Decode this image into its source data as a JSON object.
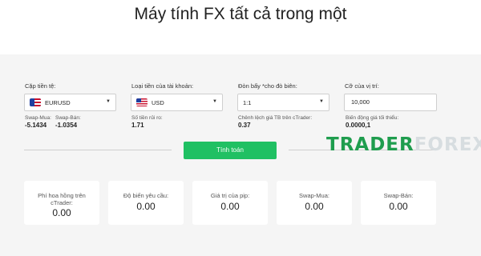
{
  "title": "Máy tính FX tất cả trong một",
  "fields": {
    "currency_pair": {
      "label": "Cặp tiền tệ:",
      "value": "EURUSD",
      "icon": "eu-flag-icon"
    },
    "account_currency": {
      "label": "Loại tiền của tài khoản:",
      "value": "USD",
      "icon": "us-flag-icon"
    },
    "leverage": {
      "label": "Đòn bẩy *cho đò biên:",
      "value": "1:1"
    },
    "lot_size": {
      "label": "Cỡ của vị trí:",
      "value": "10,000"
    }
  },
  "info": {
    "swap_buy_label": "Swap-Mua:",
    "swap_buy_value": "-5.1434",
    "swap_sell_label": "Swap-Bán:",
    "swap_sell_value": "-1.0354",
    "risk_label": "Số tiền rủi ro:",
    "risk_value": "1.71",
    "spread_label": "Chênh lệch giá TB trên cTrader:",
    "spread_value": "0.37",
    "min_move_label": "Biến động giá tối thiểu:",
    "min_move_value": "0.0000,1"
  },
  "calculate_label": "Tính toán",
  "watermark": {
    "part1": "TRADER",
    "part2": "FOREX"
  },
  "results": [
    {
      "label": "Phí hoa hồng trên cTrader:",
      "value": "0.00"
    },
    {
      "label": "Độ biến yêu cầu:",
      "value": "0.00"
    },
    {
      "label": "Giá trị của pip:",
      "value": "0.00"
    },
    {
      "label": "Swap-Mua:",
      "value": "0.00"
    },
    {
      "label": "Swap-Bán:",
      "value": "0.00"
    }
  ],
  "colors": {
    "accent": "#20c063",
    "panel_bg": "#f5f5f5",
    "watermark_green": "#1f9d4e"
  }
}
